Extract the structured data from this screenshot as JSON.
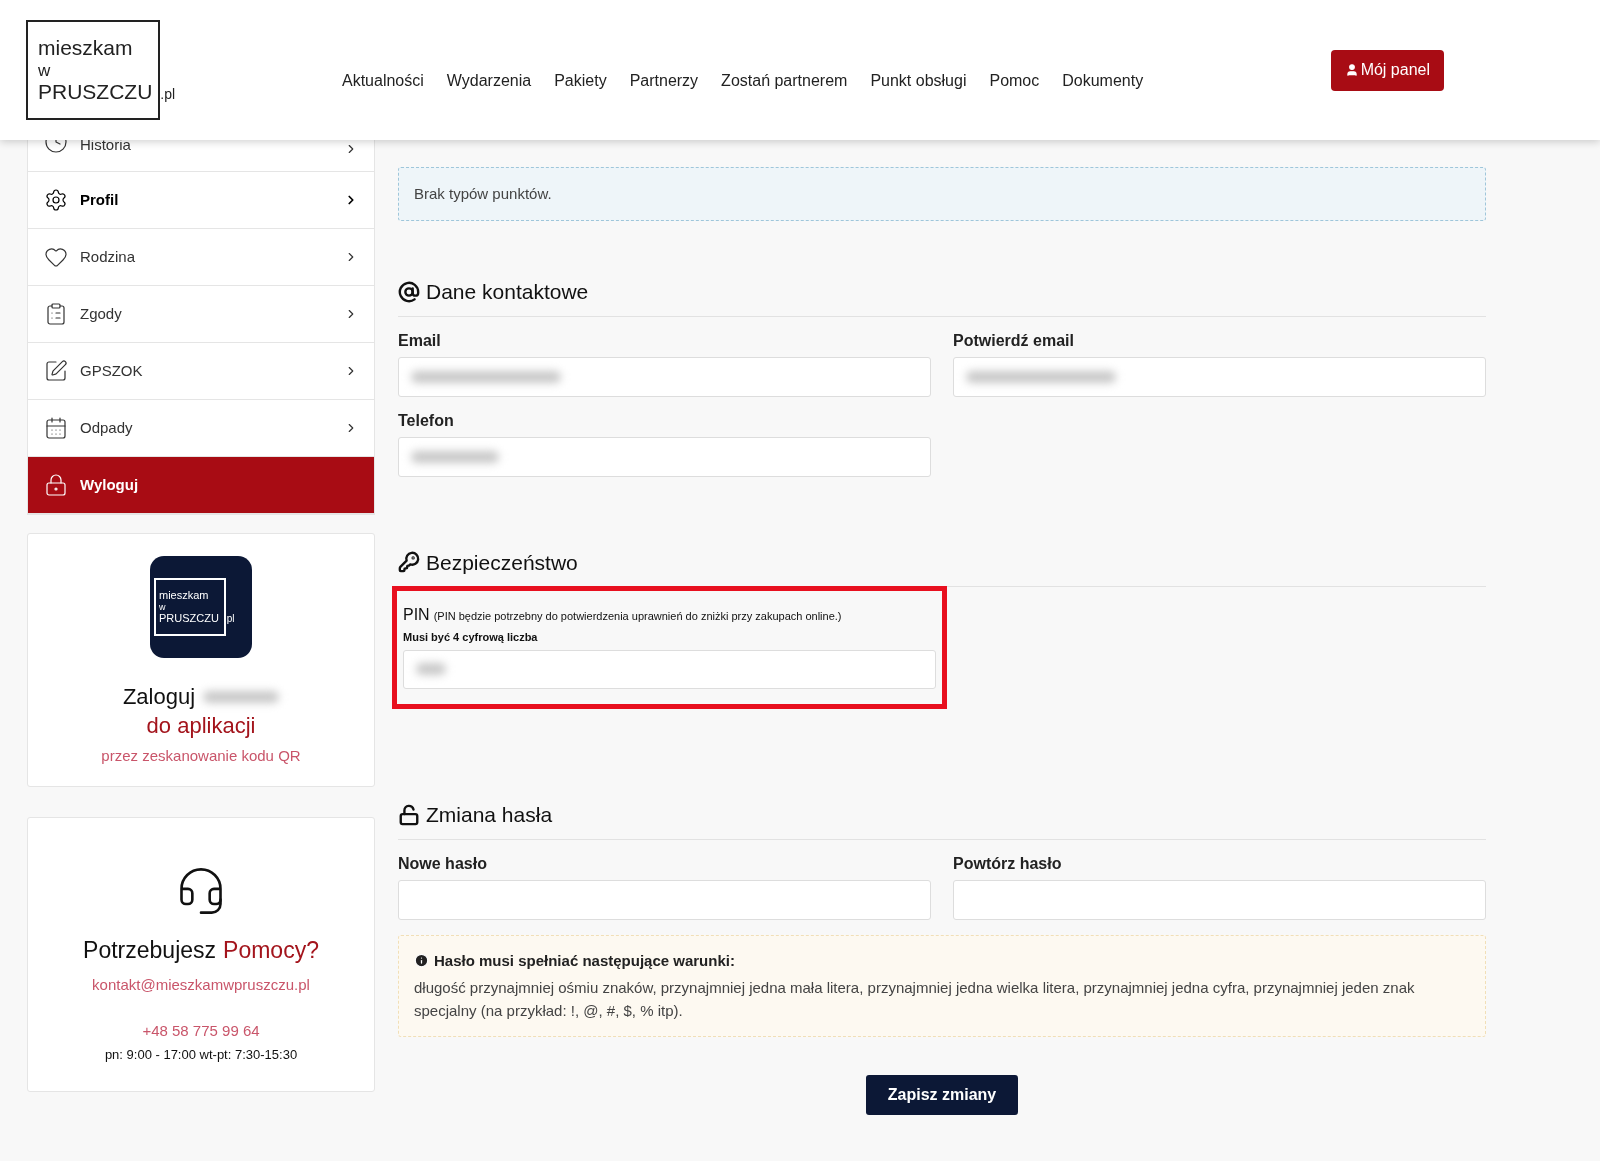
{
  "header": {
    "logo": {
      "line1": "mieszkam",
      "line2": "w",
      "line3": "PRUSZCZU",
      "suffix": ".pl"
    },
    "nav": [
      "Aktualności",
      "Wydarzenia",
      "Pakiety",
      "Partnerzy",
      "Zostań partnerem",
      "Punkt obsługi",
      "Pomoc",
      "Dokumenty"
    ],
    "panel_button": "Mój panel"
  },
  "sidebar": {
    "items": [
      {
        "label": "Historia",
        "kind": "link",
        "selected": false
      },
      {
        "label": "Profil",
        "kind": "link",
        "selected": true
      },
      {
        "label": "Rodzina",
        "kind": "link",
        "selected": false
      },
      {
        "label": "Zgody",
        "kind": "link",
        "selected": false
      },
      {
        "label": "GPSZOK",
        "kind": "link",
        "selected": false
      },
      {
        "label": "Odpady",
        "kind": "link",
        "selected": false
      },
      {
        "label": "Wyloguj",
        "kind": "logout",
        "selected": false
      }
    ],
    "app_card": {
      "logo": {
        "line1": "mieszkam",
        "line2": "w",
        "line3": "PRUSZCZU",
        "suffix": ".pl"
      },
      "title": "Zaloguj",
      "title_accent": "do aplikacji",
      "subtitle": "przez zeskanowanie kodu QR"
    },
    "help_card": {
      "title": "Potrzebujesz",
      "title_accent": "Pomocy?",
      "email": "kontakt@mieszkamwpruszczu.pl",
      "phone": "+48 58 775 99 64",
      "hours": "pn: 9:00 - 17:00 wt-pt: 7:30-15:30"
    }
  },
  "main": {
    "notice": "Brak typów punktów.",
    "contact": {
      "heading": "Dane kontaktowe",
      "fields": [
        {
          "label": "Email",
          "redacted": true
        },
        {
          "label": "Potwierdź email",
          "redacted": true
        },
        {
          "label": "Telefon",
          "redacted": true
        }
      ]
    },
    "security": {
      "heading": "Bezpieczeństwo",
      "pin_label": "PIN",
      "pin_note": "(PIN będzie potrzebny do potwierdzenia uprawnień do zniżki przy zakupach online.)",
      "pin_hint": "Musi być 4 cyfrową liczba",
      "pin_redacted": true,
      "highlighted": true
    },
    "password": {
      "heading": "Zmiana hasła",
      "fields": [
        {
          "label": "Nowe hasło",
          "redacted": false
        },
        {
          "label": "Powtórz hasło",
          "redacted": false
        }
      ],
      "rules_title": "Hasło musi spełniać następujące warunki:",
      "rules_text": "długość przynajmniej ośmiu znaków, przynajmniej jedna mała litera, przynajmniej jedna wielka litera, przynajmniej jedna cyfra, przynajmniej jeden znak specjalny (na przykład: !, @, #, $, % itp)."
    },
    "save_button": "Zapisz zmiany"
  }
}
